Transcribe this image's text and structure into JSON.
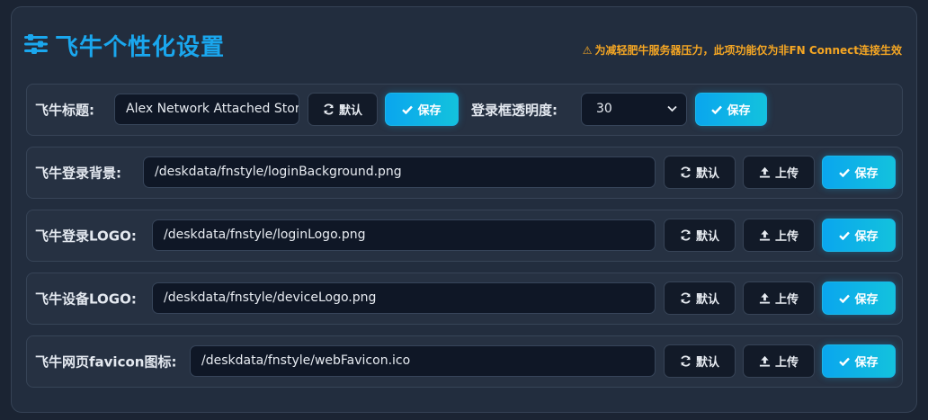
{
  "header": {
    "title": "飞牛个性化设置",
    "notice": "为减轻肥牛服务器压力，此项功能仅为非FN Connect连接生效",
    "icon": "sliders-icon",
    "accent": "#1aa7ee",
    "warning_color": "#f5a623"
  },
  "title_row": {
    "label": "飞牛标题:",
    "value": "Alex Network Attached Storage",
    "default_label": "默认",
    "save_label": "保存",
    "opacity_label": "登录框透明度:",
    "opacity_value": "30",
    "opacity_save_label": "保存"
  },
  "rows": [
    {
      "label": "飞牛登录背景:",
      "path": "/deskdata/fnstyle/loginBackground.png",
      "default_label": "默认",
      "upload_label": "上传",
      "save_label": "保存"
    },
    {
      "label": "飞牛登录LOGO:",
      "path": "/deskdata/fnstyle/loginLogo.png",
      "default_label": "默认",
      "upload_label": "上传",
      "save_label": "保存"
    },
    {
      "label": "飞牛设备LOGO:",
      "path": "/deskdata/fnstyle/deviceLogo.png",
      "default_label": "默认",
      "upload_label": "上传",
      "save_label": "保存"
    },
    {
      "label": "飞牛网页favicon图标:",
      "path": "/deskdata/fnstyle/webFavicon.ico",
      "default_label": "默认",
      "upload_label": "上传",
      "save_label": "保存"
    }
  ]
}
